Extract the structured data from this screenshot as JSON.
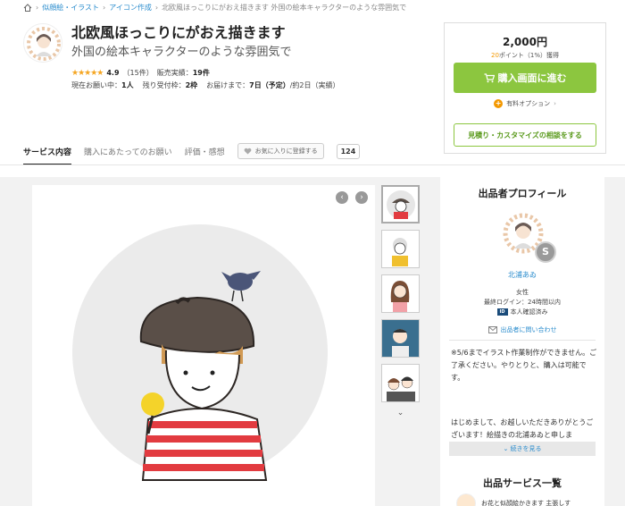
{
  "breadcrumb": {
    "items": [
      "似顔絵・イラスト",
      "アイコン作成",
      "北欧風ほっこりにがおえ描きます 外国の絵本キャラクターのような雰囲気で"
    ]
  },
  "header": {
    "title": "北欧風ほっこりにがおえ描きます",
    "subtitle": "外国の絵本キャラクターのような雰囲気で",
    "stars": "★★★★★",
    "rating": "4.9",
    "reviews": "（15件）",
    "sales_label": "販売実績：",
    "sales_value": "19件",
    "current_label": "現在お願い中：",
    "current_value": "1人",
    "remaining_label": "残り受付枠：",
    "remaining_value": "2枠",
    "delivery_label": "お届けまで：",
    "delivery_value": "7日（予定）",
    "delivery_actual": "/約2日（実績）"
  },
  "buybox": {
    "price": "2,000円",
    "points_value": "20",
    "points_text": "ポイント（1%）獲得",
    "buy_label": "購入画面に進む",
    "option_label": "有料オプション",
    "consult_label": "見積り・カスタマイズの相談をする"
  },
  "tabs": {
    "items": [
      "サービス内容",
      "購入にあたってのお願い",
      "評価・感想"
    ],
    "fav_label": "お気に入りに登録する",
    "fav_count": "124"
  },
  "gallery": {
    "prev": "‹",
    "next": "›",
    "more": "⌄"
  },
  "profile": {
    "title": "出品者プロフィール",
    "badge": "S",
    "name": "北浦あゐ",
    "gender": "女性",
    "last_login": "最終ログイン：24時間以内",
    "verified": "本人確認済み",
    "verify_icon": "ID",
    "contact": "出品者に問い合わせ",
    "notice": "※5/6までイラスト作業制作ができません。ご了承ください。やりとりと、購入は可能です。",
    "greeting": "はじめまして、お越しいただきありがとうございます！絵描きの北浦あゐと申しま",
    "readmore": "続きを見る",
    "services_title": "出品サービス一覧",
    "service_item": "お花と似顔絵かきます 主張しす"
  },
  "colors": {
    "accent_green": "#8cc63f",
    "link_blue": "#2a8ccd",
    "points_orange": "#f39800"
  }
}
